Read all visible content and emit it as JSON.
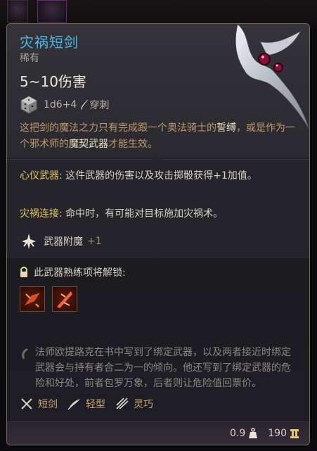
{
  "item": {
    "name": "灾祸短剑",
    "rarity": "稀有",
    "damage": "5~10伤害",
    "dice": "1d6+4",
    "damage_type": "穿刺",
    "flavor_parts": [
      "这把剑的魔法之力只有完成跟一个奥法骑士的",
      "誓缚",
      "，或是作为一个邪术师的",
      "魔契武器",
      "才能生效。"
    ]
  },
  "properties": {
    "pact_label": "心仪武器:",
    "pact_text": " 这件武器的伤害以及攻击掷骰获得+1加值。",
    "bane_label": "灾祸连接:",
    "bane_text": " 命中时，有可能对目标施加灾祸术。",
    "enchant_label": "武器附魔",
    "enchant_value": "+1"
  },
  "proficiency": {
    "header": "此武器熟练项将解锁:",
    "skills": [
      "skill-1",
      "skill-2"
    ],
    "lore": "法师欧提路克在书中写到了绑定武器，以及两者接近时绑定武器会与持有者合二为一的倾向。他还写到了绑定武器的危险和好处，前者包罗万象，后者则让危险值回票价。"
  },
  "traits": [
    "短剑",
    "轻型",
    "灵巧"
  ],
  "footer": {
    "weight": "0.9",
    "value": "190"
  },
  "colors": {
    "title": "#4fb6e8",
    "flavor": "#c09a6a",
    "label": "#e8c46e",
    "trait": "#c9a470"
  }
}
